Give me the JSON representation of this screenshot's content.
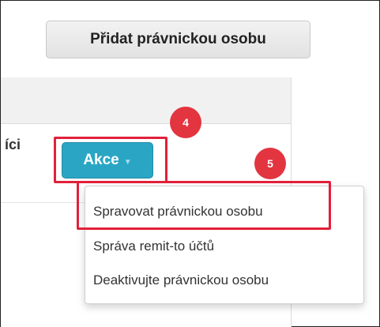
{
  "header": {
    "add_button_label": "Přidat právnickou osobu"
  },
  "table": {
    "partial_column_label": "íci"
  },
  "actions": {
    "button_label": "Akce",
    "caret": "▼"
  },
  "dropdown": {
    "items": [
      {
        "label": "Spravovat právnickou osobu"
      },
      {
        "label": "Správa remit-to účtů"
      },
      {
        "label": "Deaktivujte právnickou osobu"
      }
    ]
  },
  "annotations": {
    "step_4": "4",
    "step_5": "5",
    "highlight_color": "#e2203a"
  },
  "colors": {
    "action_button": "#2aa6c4",
    "badge": "#e23540"
  }
}
